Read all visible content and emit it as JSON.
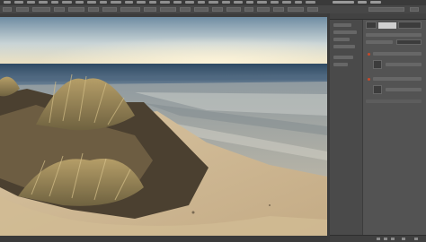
{
  "app": {
    "accent_color": "#c84a2a",
    "panel_color": "#535353",
    "workspace_color": "#4f4f4f"
  },
  "menubar": {
    "items": []
  },
  "canvas": {
    "image_description_visible": false,
    "scene": "beach-dunes-photo"
  },
  "icons": {
    "panel_menu": "hamburger-icon",
    "new_layer": "new-layer-icon",
    "trash": "trash-icon",
    "fx": "fx-icon",
    "mask": "mask-icon",
    "folder": "folder-icon"
  },
  "statusbar": {
    "text": ""
  }
}
